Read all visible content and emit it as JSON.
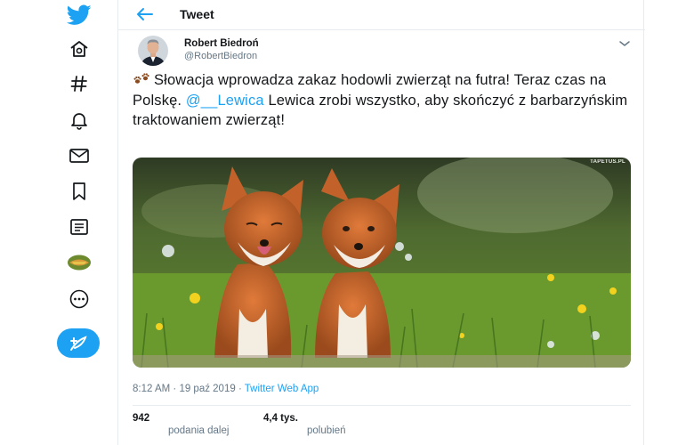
{
  "header": {
    "title": "Tweet"
  },
  "nav": {
    "items": [
      {
        "icon": "twitter-logo-icon"
      },
      {
        "icon": "home-icon"
      },
      {
        "icon": "explore-hashtag-icon"
      },
      {
        "icon": "notifications-bell-icon"
      },
      {
        "icon": "messages-envelope-icon"
      },
      {
        "icon": "bookmarks-icon"
      },
      {
        "icon": "lists-icon"
      },
      {
        "icon": "profile-avatar-icon"
      },
      {
        "icon": "more-icon"
      }
    ],
    "compose_icon": "compose-feather-icon",
    "accent": "#1da1f2"
  },
  "tweet": {
    "author_name": "Robert Biedroń",
    "author_handle": "@RobertBiedron",
    "text_before_mention": "Słowacja wprowadza zakaz hodowli zwierząt na futra! Teraz czas na Polskę. ",
    "mention": "@__Lewica",
    "text_after_mention": " Lewica zrobi wszystko, aby skończyć z barbarzyńskim traktowaniem zwierząt!",
    "emoji": "paw-prints-icon",
    "photo_watermark": "TAPETUS.PL",
    "time": "8:12 AM",
    "date": "19 paź 2019",
    "separator": " · ",
    "source": "Twitter Web App",
    "retweets_count": "942",
    "retweets_label": "podania dalej",
    "likes_count": "4,4 tys.",
    "likes_label": "polubień"
  }
}
